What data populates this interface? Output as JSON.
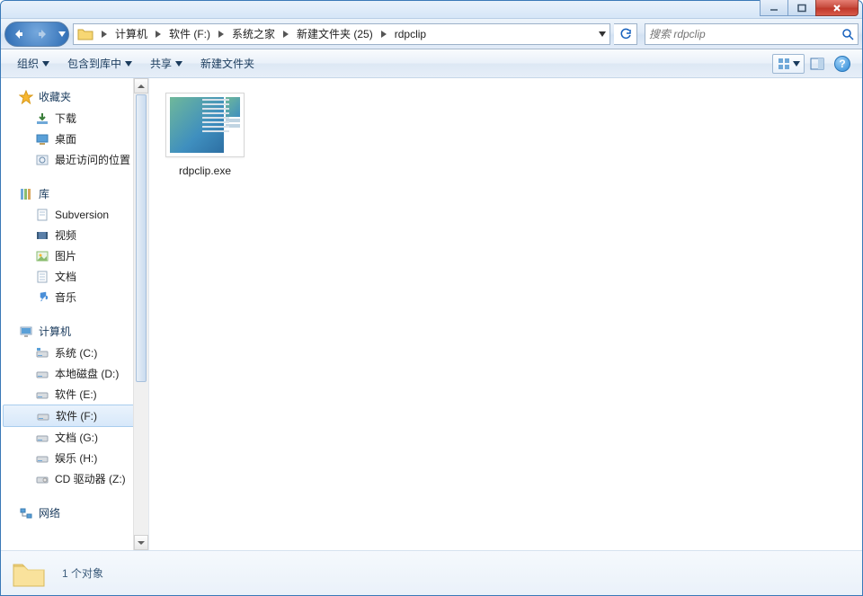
{
  "titlebar": {},
  "nav": {
    "breadcrumbs": [
      "计算机",
      "软件 (F:)",
      "系统之家",
      "新建文件夹 (25)",
      "rdpclip"
    ],
    "search_placeholder": "搜索 rdpclip"
  },
  "toolbar": {
    "organize": "组织",
    "include": "包含到库中",
    "share": "共享",
    "newfolder": "新建文件夹"
  },
  "sidebar": {
    "favorites": {
      "title": "收藏夹",
      "items": [
        "下载",
        "桌面",
        "最近访问的位置"
      ]
    },
    "libraries": {
      "title": "库",
      "items": [
        "Subversion",
        "视频",
        "图片",
        "文档",
        "音乐"
      ]
    },
    "computer": {
      "title": "计算机",
      "items": [
        "系统 (C:)",
        "本地磁盘 (D:)",
        "软件 (E:)",
        "软件 (F:)",
        "文档 (G:)",
        "娱乐 (H:)",
        "CD 驱动器 (Z:)"
      ]
    },
    "network": {
      "title": "网络"
    }
  },
  "content": {
    "files": [
      "rdpclip.exe"
    ]
  },
  "statusbar": {
    "text": "1 个对象"
  }
}
